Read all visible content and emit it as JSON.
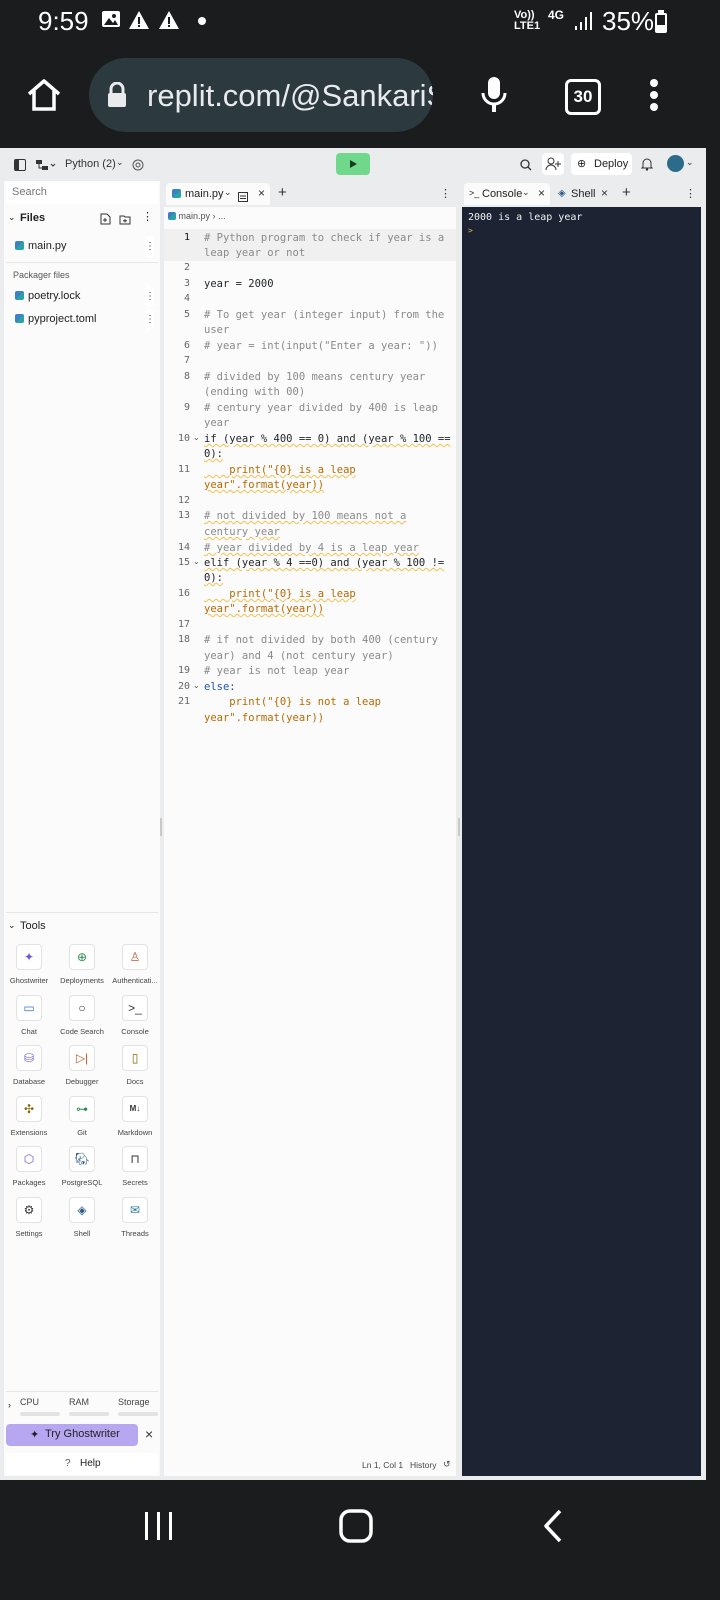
{
  "status_bar": {
    "time": "9:59",
    "network_label": "Vo)) LTE1",
    "network_type": "4G",
    "battery": "35%"
  },
  "browser": {
    "url": "replit.com/@SankariS",
    "tab_count": "30"
  },
  "toolbar": {
    "project": "Python (2)",
    "deploy_label": "Deploy"
  },
  "sidebar": {
    "search_placeholder": "Search",
    "files_label": "Files",
    "files": [
      "main.py"
    ],
    "packager_label": "Packager files",
    "packager_files": [
      "poetry.lock",
      "pyproject.toml"
    ],
    "tools_label": "Tools",
    "tools": [
      {
        "label": "Ghostwriter",
        "icon": "ghostwriter-icon"
      },
      {
        "label": "Deployments",
        "icon": "deployments-icon"
      },
      {
        "label": "Authenticati...",
        "icon": "authentication-icon"
      },
      {
        "label": "Chat",
        "icon": "chat-icon"
      },
      {
        "label": "Code Search",
        "icon": "search-icon"
      },
      {
        "label": "Console",
        "icon": "console-icon"
      },
      {
        "label": "Database",
        "icon": "database-icon"
      },
      {
        "label": "Debugger",
        "icon": "debugger-icon"
      },
      {
        "label": "Docs",
        "icon": "docs-icon"
      },
      {
        "label": "Extensions",
        "icon": "extensions-icon"
      },
      {
        "label": "Git",
        "icon": "git-icon"
      },
      {
        "label": "Markdown",
        "icon": "markdown-icon"
      },
      {
        "label": "Packages",
        "icon": "packages-icon"
      },
      {
        "label": "PostgreSQL",
        "icon": "postgresql-icon"
      },
      {
        "label": "Secrets",
        "icon": "lock-icon"
      },
      {
        "label": "Settings",
        "icon": "gear-icon"
      },
      {
        "label": "Shell",
        "icon": "shell-icon"
      },
      {
        "label": "Threads",
        "icon": "threads-icon"
      }
    ],
    "resources": [
      "CPU",
      "RAM",
      "Storage"
    ],
    "try_ghostwriter_label": "Try Ghostwriter",
    "help_label": "Help"
  },
  "editor": {
    "tab_label": "main.py",
    "breadcrumb": "main.py",
    "breadcrumb_more": "...",
    "line_numbers": [
      "1",
      "2",
      "3",
      "4",
      "5",
      "6",
      "7",
      "8",
      "9",
      "10",
      "11",
      "12",
      "13",
      "14",
      "15",
      "16",
      "17",
      "18",
      "19",
      "20",
      "21"
    ],
    "code_lines": [
      "# Python program to check if year is a",
      "leap year or not",
      "year = 2000",
      "# To get year (integer input) from the",
      "user",
      "# year = int(input(\"Enter a year: \"))",
      "# divided by 100 means century year",
      "(ending with 00)",
      "# century year divided by 400 is leap",
      "year",
      "if (year % 400 == 0) and (year % 100 ==",
      "0):",
      "    print(\"{0} is a leap",
      "year\".format(year))",
      "# not divided by 100 means not a",
      "century year",
      "# year divided by 4 is a leap year",
      "elif (year % 4 ==0) and (year % 100 !=",
      "0):",
      "    print(\"{0} is a leap",
      "year\".format(year))",
      "# if not divided by both 400 (century",
      "year) and 4 (not century year)",
      "# year is not leap year",
      "else:",
      "    print(\"{0} is not a leap",
      "year\".format(year))"
    ],
    "status_position": "Ln 1, Col 1",
    "history_label": "History"
  },
  "console": {
    "tab_console": "Console",
    "tab_shell": "Shell",
    "output": "2000 is a leap year",
    "prompt": ">"
  }
}
